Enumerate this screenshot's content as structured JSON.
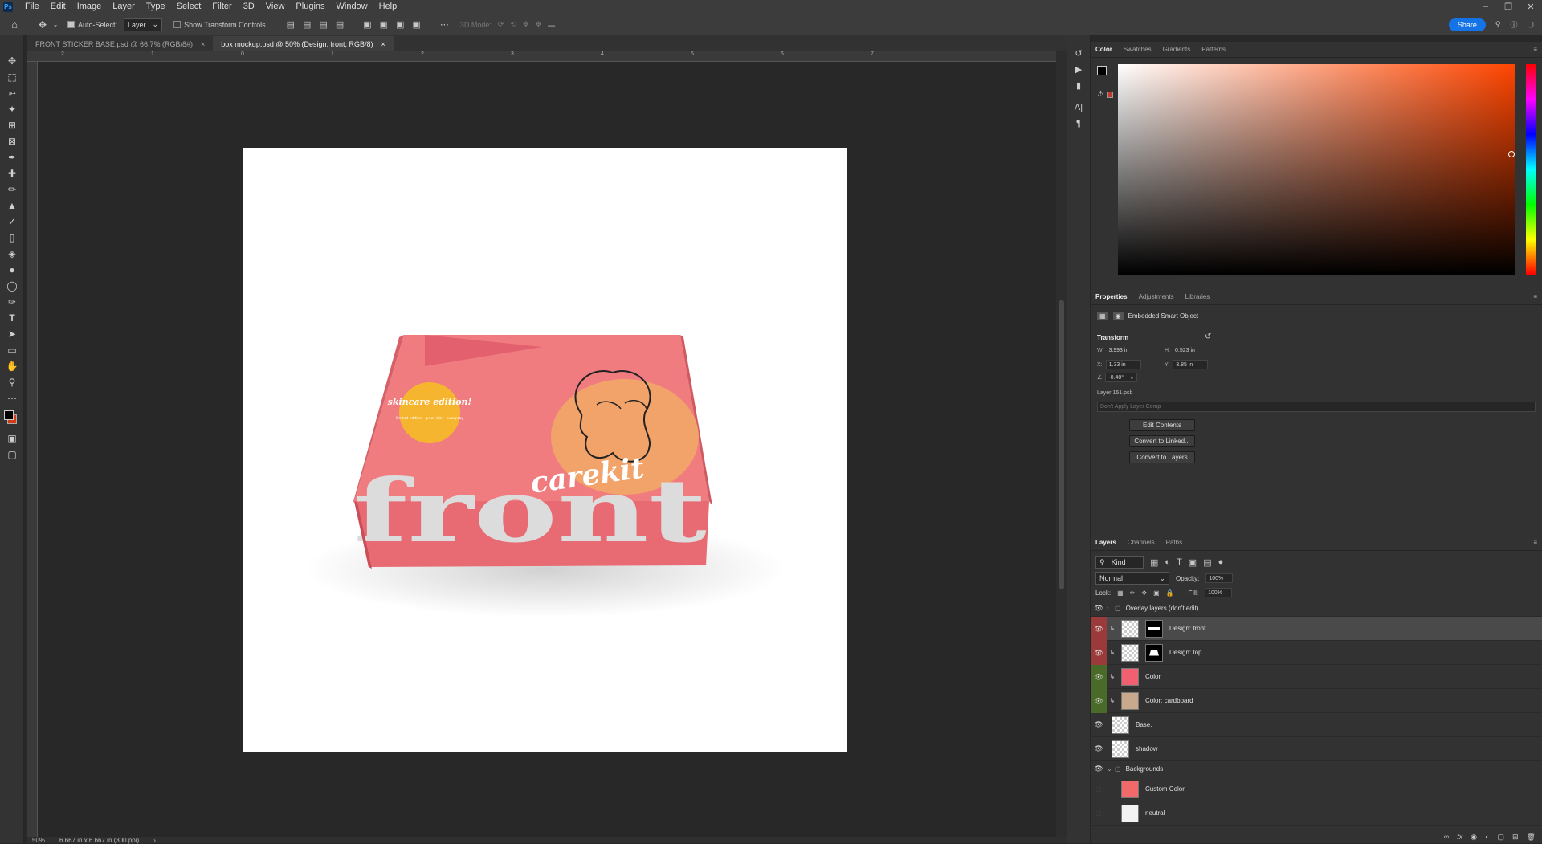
{
  "menubar": {
    "logo": "Ps",
    "items": [
      "File",
      "Edit",
      "Image",
      "Layer",
      "Type",
      "Select",
      "Filter",
      "3D",
      "View",
      "Plugins",
      "Window",
      "Help"
    ]
  },
  "optionsbar": {
    "auto_select_label": "Auto-Select:",
    "auto_select_value": "Layer",
    "transform_controls_label": "Show Transform Controls",
    "mode_3d": "3D Mode:",
    "share_label": "Share"
  },
  "tabs": [
    {
      "label": "FRONT STICKER BASE.psd @ 66.7% (RGB/8#)",
      "active": false
    },
    {
      "label": "box mockup.psd @ 50% (Design: front, RGB/8)",
      "active": true
    }
  ],
  "ruler_labels": [
    "2",
    "1",
    "0",
    "1",
    "2",
    "3",
    "4",
    "5",
    "6",
    "7"
  ],
  "artwork": {
    "brand": "carekit",
    "word": "front",
    "badge_title": "skincare edition!",
    "badge_sub": "limited edition · great skin · everyday"
  },
  "status": {
    "zoom": "50%",
    "doc_size": "6.667 in x 6.667 in (300 ppi)"
  },
  "color_panel": {
    "tabs": [
      "Color",
      "Swatches",
      "Gradients",
      "Patterns"
    ],
    "active": "Color",
    "hue_color": "#ff4500"
  },
  "properties": {
    "tabs": [
      "Properties",
      "Adjustments",
      "Libraries"
    ],
    "active": "Properties",
    "type_label": "Embedded Smart Object",
    "transform_label": "Transform",
    "w_label": "W:",
    "w_value": "3.993 in",
    "h_label": "H:",
    "h_value": "0.523 in",
    "x_label": "X:",
    "x_value": "1.33 in",
    "y_label": "Y:",
    "y_value": "3.85 in",
    "angle_value": "-0.40°",
    "file_name": "Layer 151.psb",
    "layer_comp": "Don't Apply Layer Comp",
    "buttons": [
      "Edit Contents",
      "Convert to Linked...",
      "Convert to Layers"
    ]
  },
  "layers_panel": {
    "tabs": [
      "Layers",
      "Channels",
      "Paths"
    ],
    "active": "Layers",
    "filter": "Kind",
    "blend_mode": "Normal",
    "opacity_label": "Opacity:",
    "opacity_value": "100%",
    "lock_label": "Lock:",
    "fill_label": "Fill:",
    "fill_value": "100%",
    "layers": [
      {
        "name": "Overlay layers (don't edit)",
        "kind": "group",
        "visible": true,
        "tag": ""
      },
      {
        "name": "Design: front",
        "kind": "smart",
        "visible": true,
        "tag": "red",
        "selected": true
      },
      {
        "name": "Design: top",
        "kind": "smart",
        "visible": true,
        "tag": "red"
      },
      {
        "name": "Color",
        "kind": "fill",
        "visible": true,
        "tag": "green",
        "swatch": "#f06070"
      },
      {
        "name": "Color: cardboard",
        "kind": "fill",
        "visible": true,
        "tag": "green",
        "swatch": "#c9a98c"
      },
      {
        "name": "Base.",
        "kind": "pixel",
        "visible": true,
        "tag": ""
      },
      {
        "name": "shadow",
        "kind": "pixel",
        "visible": true,
        "tag": ""
      },
      {
        "name": "Backgrounds",
        "kind": "group",
        "visible": true,
        "tag": ""
      },
      {
        "name": "Custom Color",
        "kind": "fill",
        "visible": false,
        "tag": "",
        "swatch": "#f06a6a"
      },
      {
        "name": "neutral",
        "kind": "fill",
        "visible": false,
        "tag": "",
        "swatch": "#f2f2f2"
      }
    ]
  }
}
